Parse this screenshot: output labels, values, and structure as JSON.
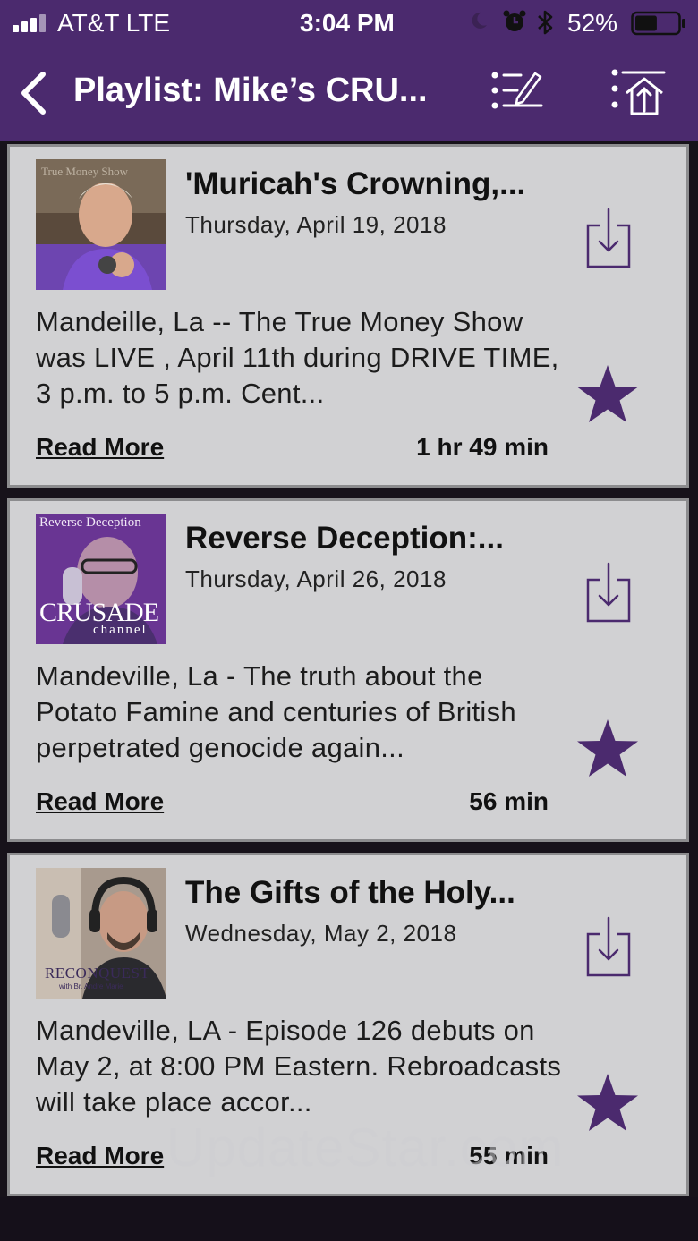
{
  "status_bar": {
    "carrier": "AT&T  LTE",
    "time": "3:04 PM",
    "battery_percent": "52%",
    "battery_level": 0.52,
    "icons": [
      "signal-icon",
      "moon-icon",
      "alarm-icon",
      "bluetooth-icon",
      "battery-icon"
    ]
  },
  "nav": {
    "title": "Playlist: Mike’s CRU...",
    "icons": [
      "back-chevron-icon",
      "edit-list-icon",
      "share-list-icon"
    ]
  },
  "theme": {
    "accent": "#4b2a6e",
    "card_bg": "#d1d1d3",
    "icon_purple": "#4b2a6e"
  },
  "episodes": [
    {
      "title": "'Muricah's Crowning,...",
      "date": "Thursday, April 19, 2018",
      "description": "Mandeille, La -- The True Money Show was LIVE , April 11th during DRIVE TIME, 3 p.m. to 5 p.m. Cent...",
      "read_more": "Read More",
      "duration": "1 hr 49 min",
      "thumb_overlay": "True Money Show"
    },
    {
      "title": "Reverse Deception:...",
      "date": "Thursday, April 26, 2018",
      "description": "Mandeville, La - The truth about the Potato Famine and centuries of British perpetrated genocide again...",
      "read_more": "Read More",
      "duration": "56 min",
      "thumb_overlay": "Reverse Deception",
      "thumb_brand": "CRUSADE",
      "thumb_brand_sub": "channel"
    },
    {
      "title": "The Gifts of the Holy...",
      "date": "Wednesday, May 2, 2018",
      "description": "Mandeville, LA - Episode 126 debuts on May 2, at 8:00 PM Eastern. Rebroadcasts will take place accor...",
      "read_more": "Read More",
      "duration": "55 min",
      "thumb_brand": "RECONQUEST",
      "thumb_brand_sub": "with Br. Andre Marie"
    }
  ],
  "watermark": "UpdateStar.com"
}
